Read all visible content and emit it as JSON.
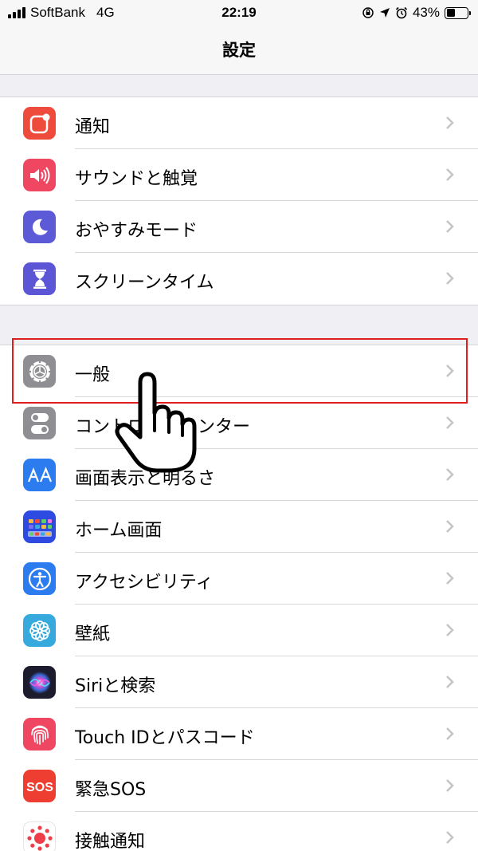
{
  "status_bar": {
    "carrier": "SoftBank",
    "network": "4G",
    "time": "22:19",
    "battery": "43%",
    "battery_level": 0.43,
    "icons": [
      "orientation-lock-icon",
      "location-icon",
      "alarm-icon"
    ]
  },
  "nav": {
    "title": "設定"
  },
  "groups": [
    {
      "items": [
        {
          "label": "通知",
          "icon": "notifications-icon",
          "color": "#ee4b3d"
        },
        {
          "label": "サウンドと触覚",
          "icon": "speaker-icon",
          "color": "#ef4761"
        },
        {
          "label": "おやすみモード",
          "icon": "moon-icon",
          "color": "#5d5ad8"
        },
        {
          "label": "スクリーンタイム",
          "icon": "hourglass-icon",
          "color": "#5c56d6"
        }
      ]
    },
    {
      "items": [
        {
          "label": "一般",
          "icon": "gear-icon",
          "color": "#8e8e93"
        },
        {
          "label": "コントロールセンター",
          "icon": "toggles-icon",
          "color": "#8e8e93"
        },
        {
          "label": "画面表示と明るさ",
          "icon": "text-size-icon",
          "color": "#2c7cf0"
        },
        {
          "label": "ホーム画面",
          "icon": "home-screen-icon",
          "color": "#2d4be0"
        },
        {
          "label": "アクセシビリティ",
          "icon": "accessibility-icon",
          "color": "#2c7cf0"
        },
        {
          "label": "壁紙",
          "icon": "wallpaper-icon",
          "color": "#36aadc"
        },
        {
          "label": "Siriと検索",
          "icon": "siri-icon",
          "color": "#1c1c2e"
        },
        {
          "label": "Touch IDとパスコード",
          "icon": "fingerprint-icon",
          "color": "#ef4761"
        },
        {
          "label": "緊急SOS",
          "icon": "sos-icon",
          "color": "#ee3e32"
        },
        {
          "label": "接触通知",
          "icon": "exposure-notification-icon",
          "color": "#ffffff"
        }
      ]
    }
  ],
  "annotation": {
    "highlighted_item": "一般"
  }
}
